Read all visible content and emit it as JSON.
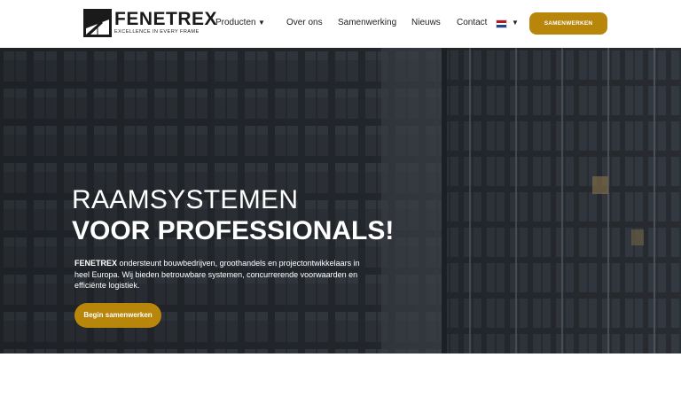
{
  "brand": {
    "name": "FENETREX",
    "tagline": "EXCELLENCE IN EVERY FRAME"
  },
  "nav": {
    "items": [
      {
        "label": "Producten",
        "has_dropdown": true
      },
      {
        "label": "Over ons"
      },
      {
        "label": "Samenwerking"
      },
      {
        "label": "Nieuws"
      },
      {
        "label": "Contact"
      }
    ],
    "language_flag": "flag-nl-icon",
    "cta_label": "SAMENWERKEN"
  },
  "hero": {
    "title_line1": "RAAMSYSTEMEN",
    "title_line2": "VOOR PROFESSIONALS!",
    "body_brand": "FENETREX",
    "body_text": " ondersteunt bouwbedrijven, groothandels en projectontwikkelaars in heel Europa. Wij bieden betrouwbare systemen, concurrerende voorwaarden en efficiënte logistiek.",
    "button_label": "Begin samenwerken"
  },
  "colors": {
    "accent": "#b8860b",
    "hero_bg": "#2c3036",
    "text_dark": "#222222",
    "white": "#ffffff"
  }
}
